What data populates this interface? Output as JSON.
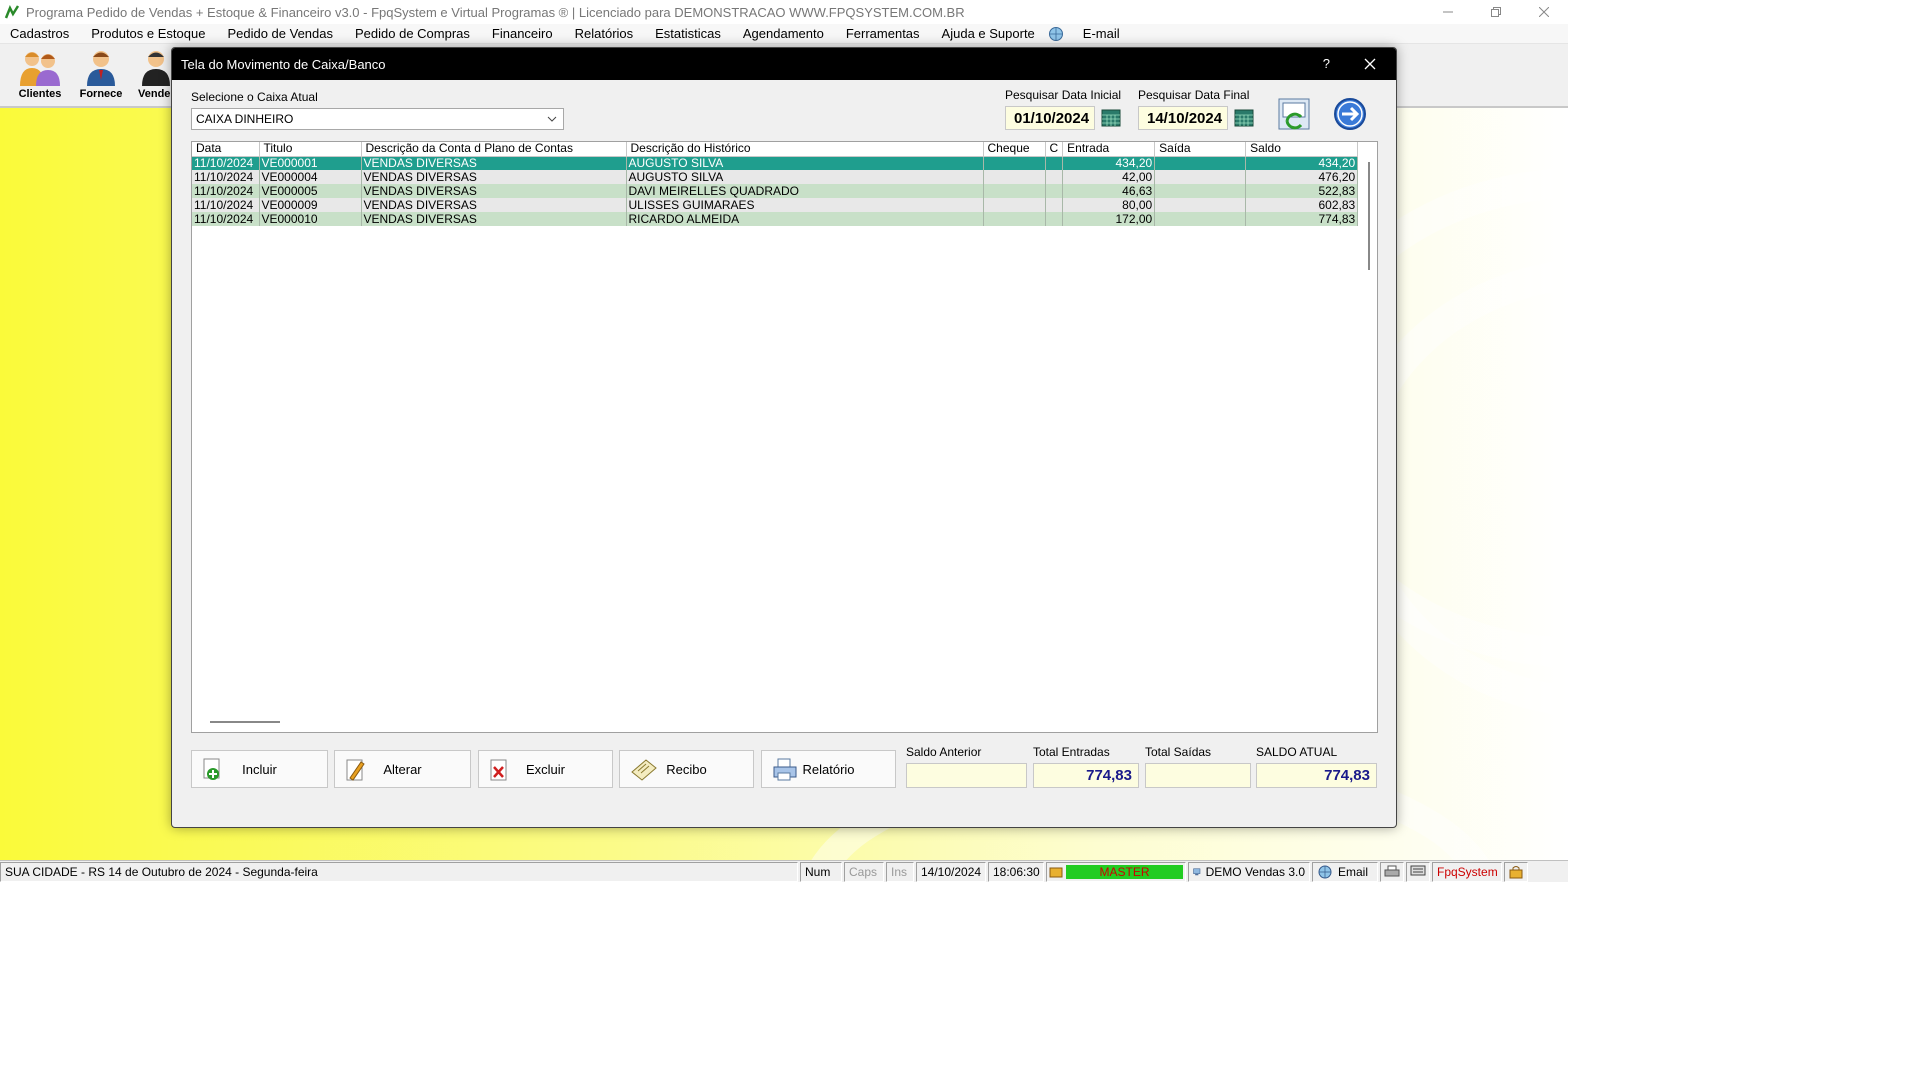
{
  "window": {
    "title": "Programa Pedido de Vendas + Estoque & Financeiro v3.0 - FpqSystem e Virtual Programas ® | Licenciado para  DEMONSTRACAO WWW.FPQSYSTEM.COM.BR"
  },
  "menu": [
    "Cadastros",
    "Produtos e Estoque",
    "Pedido de Vendas",
    "Pedido de Compras",
    "Financeiro",
    "Relatórios",
    "Estatisticas",
    "Agendamento",
    "Ferramentas",
    "Ajuda e Suporte"
  ],
  "menu_email": "E-mail",
  "toolbar": {
    "clientes": "Clientes",
    "fornece": "Fornece",
    "vende": "Vende"
  },
  "dialog": {
    "title": "Tela do Movimento de Caixa/Banco",
    "help": "?",
    "caixa_label": "Selecione o Caixa Atual",
    "caixa_value": "CAIXA DINHEIRO",
    "data_inicial_label": "Pesquisar Data Inicial",
    "data_inicial": "01/10/2024",
    "data_final_label": "Pesquisar Data Final",
    "data_final": "14/10/2024"
  },
  "grid": {
    "columns": [
      "Data",
      "Titulo",
      "Descrição da Conta d Plano de Contas",
      "Descrição do Histórico",
      "Cheque",
      "C",
      "Entrada",
      "Saída",
      "Saldo"
    ],
    "rows": [
      [
        "11/10/2024",
        "VE000001",
        "VENDAS DIVERSAS",
        "AUGUSTO SILVA",
        "",
        "",
        "434,20",
        "",
        "434,20"
      ],
      [
        "11/10/2024",
        "VE000004",
        "VENDAS DIVERSAS",
        "AUGUSTO SILVA",
        "",
        "",
        "42,00",
        "",
        "476,20"
      ],
      [
        "11/10/2024",
        "VE000005",
        "VENDAS DIVERSAS",
        "DAVI MEIRELLES QUADRADO",
        "",
        "",
        "46,63",
        "",
        "522,83"
      ],
      [
        "11/10/2024",
        "VE000009",
        "VENDAS DIVERSAS",
        "ULISSES GUIMARAES",
        "",
        "",
        "80,00",
        "",
        "602,83"
      ],
      [
        "11/10/2024",
        "VE000010",
        "VENDAS DIVERSAS",
        "RICARDO ALMEIDA",
        "",
        "",
        "172,00",
        "",
        "774,83"
      ]
    ]
  },
  "actions": {
    "incluir": "Incluir",
    "alterar": "Alterar",
    "excluir": "Excluir",
    "recibo": "Recibo",
    "relatorio": "Relatório"
  },
  "totals": {
    "saldo_anterior_label": "Saldo Anterior",
    "saldo_anterior": "",
    "total_entradas_label": "Total Entradas",
    "total_entradas": "774,83",
    "total_saidas_label": "Total Saídas",
    "total_saidas": "",
    "saldo_atual_label": "SALDO ATUAL",
    "saldo_atual": "774,83"
  },
  "status": {
    "local": "SUA CIDADE - RS 14 de Outubro de 2024 - Segunda-feira",
    "num": "Num",
    "caps": "Caps",
    "ins": "Ins",
    "date": "14/10/2024",
    "time": "18:06:30",
    "user": "MASTER",
    "version": "DEMO Vendas 3.0",
    "email": "Email",
    "brand": "FpqSystem"
  },
  "colors": {
    "selected_row": "#1f9e8e",
    "row_green": "#c8e0c8",
    "row_gray": "#e8e8e8",
    "total_text": "#1a1a8a",
    "status_user_bg": "#22cc22",
    "status_user_text": "#cc0000",
    "brand_red": "#cc0000"
  }
}
